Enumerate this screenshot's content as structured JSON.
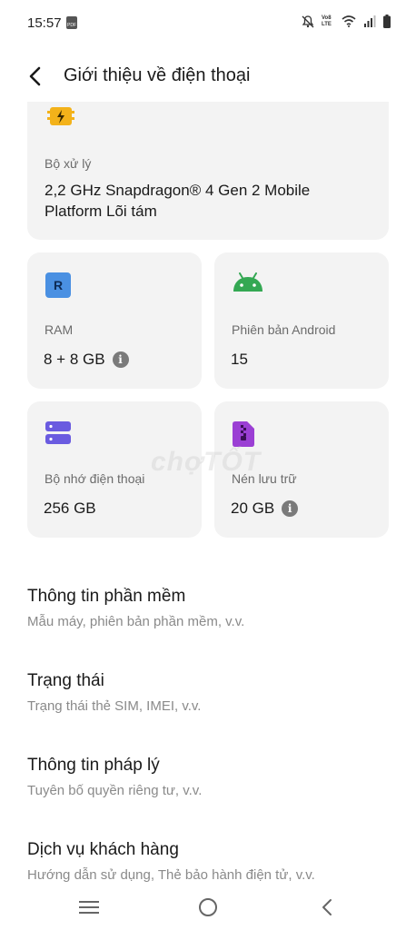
{
  "status_bar": {
    "time": "15:57",
    "icons": [
      "pdf-notification-icon",
      "mute-icon",
      "volte-icon",
      "wifi-icon",
      "signal-icon",
      "battery-icon"
    ],
    "volte_text": "Vo8 LTE"
  },
  "header": {
    "title": "Giới thiệu về điện thoại"
  },
  "cards": {
    "processor": {
      "label": "Bộ xử lý",
      "value": "2,2 GHz Snapdragon® 4 Gen 2 Mobile Platform Lõi tám",
      "icon": "processor-icon",
      "icon_color": "#f3b21a"
    },
    "ram": {
      "label": "RAM",
      "value": "8 + 8 GB",
      "icon": "ram-icon",
      "icon_letter": "R",
      "icon_color": "#4a90e2"
    },
    "android": {
      "label": "Phiên bản Android",
      "value": "15",
      "icon": "android-icon",
      "icon_color": "#34a853"
    },
    "storage": {
      "label": "Bộ nhớ điện thoại",
      "value": "256 GB",
      "icon": "storage-icon",
      "icon_color": "#6a5be0"
    },
    "compression": {
      "label": "Nén lưu trữ",
      "value": "20 GB",
      "icon": "compress-icon",
      "icon_color": "#9b3fd4"
    }
  },
  "list": [
    {
      "title": "Thông tin phần mềm",
      "subtitle": "Mẫu máy, phiên bản phần mềm, v.v."
    },
    {
      "title": "Trạng thái",
      "subtitle": "Trạng thái thẻ SIM, IMEI, v.v."
    },
    {
      "title": "Thông tin pháp lý",
      "subtitle": "Tuyên bố quyền riêng tư, v.v."
    },
    {
      "title": "Dịch vụ khách hàng",
      "subtitle": "Hướng dẫn sử dụng, Thẻ bảo hành điện tử, v.v."
    }
  ],
  "watermark": "chợTỐT",
  "nav": [
    "menu-icon",
    "home-icon",
    "back-icon"
  ]
}
